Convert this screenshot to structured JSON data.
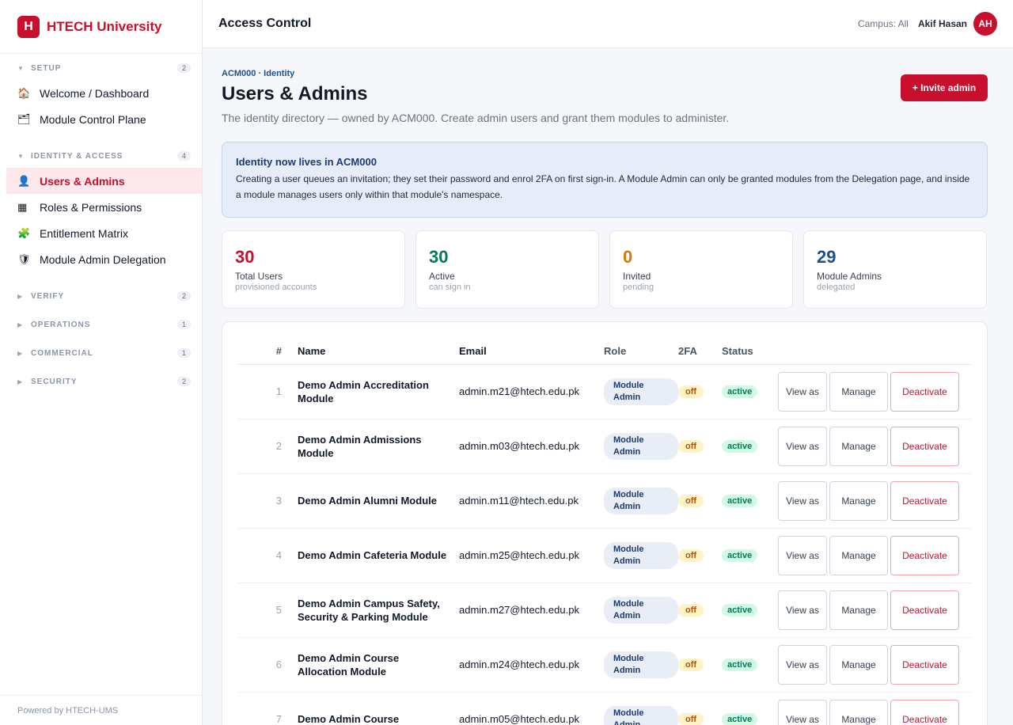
{
  "brand": {
    "logo_letter": "H",
    "name": "HTECH University"
  },
  "sidebar": {
    "sections": [
      {
        "label": "SETUP",
        "count": "2",
        "expanded": true,
        "items": [
          {
            "label": "Welcome / Dashboard",
            "icon": "house-icon",
            "glyph": "🏠"
          },
          {
            "label": "Module Control Plane",
            "icon": "folder-icon",
            "glyph": "🗂"
          }
        ]
      },
      {
        "label": "IDENTITY & ACCESS",
        "count": "4",
        "expanded": true,
        "items": [
          {
            "label": "Users & Admins",
            "icon": "user-icon",
            "glyph": "👤",
            "active": true
          },
          {
            "label": "Roles & Permissions",
            "icon": "grid-icon",
            "glyph": "▦"
          },
          {
            "label": "Entitlement Matrix",
            "icon": "puzzle-icon",
            "glyph": "🧩"
          },
          {
            "label": "Module Admin Delegation",
            "icon": "shield-icon",
            "glyph": "🛡"
          }
        ]
      },
      {
        "label": "VERIFY",
        "count": "2",
        "expanded": false,
        "items": []
      },
      {
        "label": "OPERATIONS",
        "count": "1",
        "expanded": false,
        "items": []
      },
      {
        "label": "COMMERCIAL",
        "count": "1",
        "expanded": false,
        "items": []
      },
      {
        "label": "SECURITY",
        "count": "2",
        "expanded": false,
        "items": []
      }
    ],
    "footer": "Powered by HTECH-UMS"
  },
  "topbar": {
    "title": "Access Control",
    "campus": "Campus: All",
    "user_name": "Akif Hasan",
    "avatar_initials": "AH"
  },
  "page": {
    "breadcrumb": "ACM000 · Identity",
    "title": "Users & Admins",
    "invite_label": "+ Invite admin",
    "subtitle": "The identity directory — owned by ACM000. Create admin users and grant them modules to administer."
  },
  "banner": {
    "title": "Identity now lives in ACM000",
    "text": "Creating a user queues an invitation; they set their password and enrol 2FA on first sign-in. A Module Admin can only be granted modules from the Delegation page, and inside a module manages users only within that module's namespace."
  },
  "stats": [
    {
      "value": "30",
      "label": "Total Users",
      "sub": "provisioned accounts",
      "color": "#c8102e"
    },
    {
      "value": "30",
      "label": "Active",
      "sub": "can sign in",
      "color": "#047857"
    },
    {
      "value": "0",
      "label": "Invited",
      "sub": "pending",
      "color": "#d97706"
    },
    {
      "value": "29",
      "label": "Module Admins",
      "sub": "delegated",
      "color": "#1f4e8c"
    }
  ],
  "table": {
    "headers": {
      "num": "#",
      "name": "Name",
      "email": "Email",
      "role": "Role",
      "twofa": "2FA",
      "status": "Status"
    },
    "actions": {
      "view": "View as",
      "manage": "Manage",
      "deactivate": "Deactivate"
    },
    "rows": [
      {
        "num": "1",
        "name": "Demo Admin Accreditation Module",
        "email": "admin.m21@htech.edu.pk",
        "role": "Module Admin",
        "twofa": "off",
        "status": "active"
      },
      {
        "num": "2",
        "name": "Demo Admin Admissions Module",
        "email": "admin.m03@htech.edu.pk",
        "role": "Module Admin",
        "twofa": "off",
        "status": "active"
      },
      {
        "num": "3",
        "name": "Demo Admin Alumni Module",
        "email": "admin.m11@htech.edu.pk",
        "role": "Module Admin",
        "twofa": "off",
        "status": "active"
      },
      {
        "num": "4",
        "name": "Demo Admin Cafeteria Module",
        "email": "admin.m25@htech.edu.pk",
        "role": "Module Admin",
        "twofa": "off",
        "status": "active"
      },
      {
        "num": "5",
        "name": "Demo Admin Campus Safety, Security & Parking Module",
        "email": "admin.m27@htech.edu.pk",
        "role": "Module Admin",
        "twofa": "off",
        "status": "active"
      },
      {
        "num": "6",
        "name": "Demo Admin Course Allocation Module",
        "email": "admin.m24@htech.edu.pk",
        "role": "Module Admin",
        "twofa": "off",
        "status": "active"
      },
      {
        "num": "7",
        "name": "Demo Admin Course",
        "email": "admin.m05@htech.edu.pk",
        "role": "Module Admin",
        "twofa": "off",
        "status": "active"
      }
    ]
  }
}
